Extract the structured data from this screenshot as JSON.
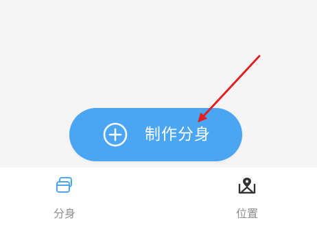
{
  "main": {
    "create_button": {
      "label": "制作分身",
      "icon": "plus-circle-icon",
      "color": "#4aa6f3"
    }
  },
  "bottom_nav": {
    "items": [
      {
        "label": "分身",
        "icon": "clone-cards-icon",
        "color": "#4aa6f3",
        "active": true
      },
      {
        "label": "位置",
        "icon": "location-map-icon",
        "color": "#333333",
        "active": false
      }
    ],
    "label_color": "#8e8e8e"
  },
  "annotation": {
    "icon": "red-arrow-icon",
    "color": "#e02020"
  }
}
